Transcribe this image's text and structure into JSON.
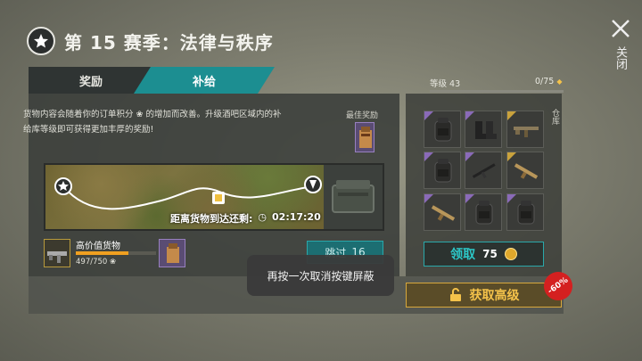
{
  "header": {
    "title": "第 15 赛季：法律与秩序",
    "badge_icon": "season-star-badge"
  },
  "close": {
    "label": "关闭"
  },
  "tabs": [
    {
      "label": "奖励",
      "active": false
    },
    {
      "label": "补给",
      "active": true
    }
  ],
  "supply": {
    "description": "货物内容会随着你的订单积分 ❀ 的增加而改善。升级酒吧区域内的补给库等级即可获得更加丰厚的奖励!",
    "best_reward_label": "最佳奖励",
    "timer_label": "距离货物到达还剩:",
    "timer_value": "02:17:20",
    "high_value": {
      "title": "高价值货物",
      "count": "497/750",
      "progress": 0.66
    },
    "skip": {
      "label": "跳过",
      "amount": "16"
    }
  },
  "level": {
    "label": "等级 43",
    "count": "0/75"
  },
  "warehouse_label": "仓库",
  "items": [
    {
      "name": "backpack",
      "rarity": "epic"
    },
    {
      "name": "boots",
      "rarity": "epic"
    },
    {
      "name": "rifle",
      "rarity": "legendary"
    },
    {
      "name": "backpack",
      "rarity": "epic"
    },
    {
      "name": "rifle-dark",
      "rarity": "epic"
    },
    {
      "name": "rifle-tan",
      "rarity": "legendary"
    },
    {
      "name": "rifle-tan",
      "rarity": "epic"
    },
    {
      "name": "backpack",
      "rarity": "epic"
    },
    {
      "name": "backpack",
      "rarity": "epic"
    }
  ],
  "claim": {
    "label": "领取",
    "amount": "75"
  },
  "toast": "再按一次取消按键屏蔽",
  "premium": {
    "label": "获取高级",
    "discount": "-60%"
  },
  "colors": {
    "accent": "#1c8e91",
    "gold": "#f4c24a",
    "epic": "#8a6ab8",
    "legendary": "#c9a23c",
    "discount": "#d42020"
  }
}
